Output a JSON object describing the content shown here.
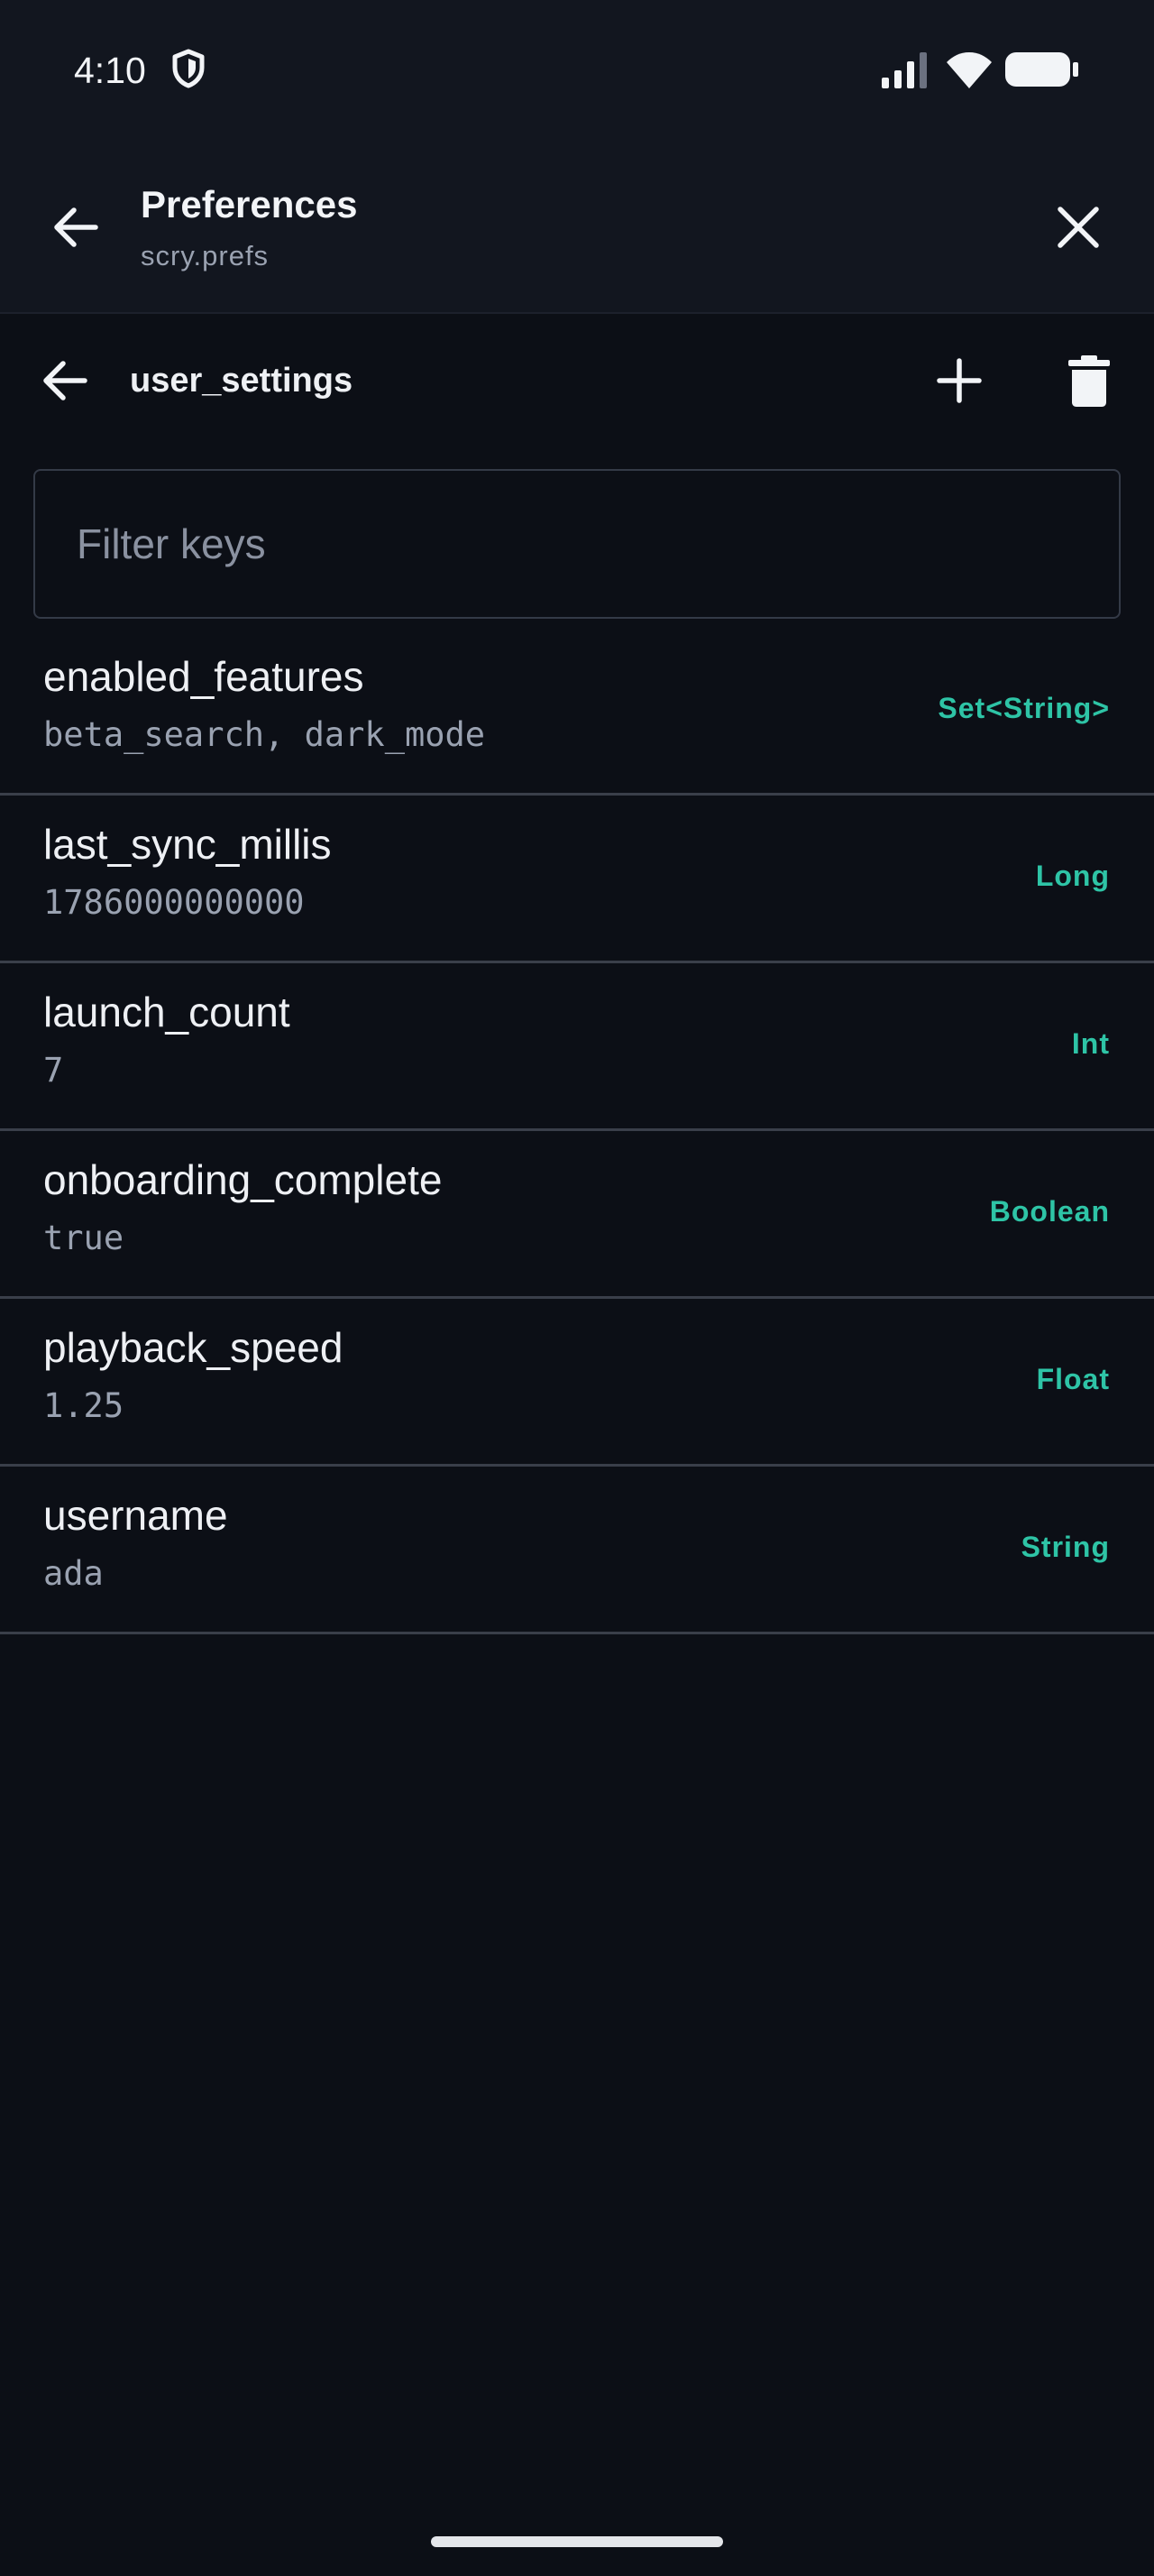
{
  "status_bar": {
    "time": "4:10",
    "icons": [
      "shield-icon",
      "signal-icon",
      "wifi-icon",
      "battery-icon"
    ]
  },
  "top_bar": {
    "title": "Preferences",
    "subtitle": "scry.prefs",
    "icons": [
      "arrow-back-icon",
      "close-icon"
    ]
  },
  "section": {
    "title": "user_settings",
    "icons": [
      "arrow-back-icon",
      "plus-icon",
      "trash-icon"
    ]
  },
  "filter": {
    "placeholder": "Filter keys",
    "value": ""
  },
  "preferences": [
    {
      "key": "enabled_features",
      "value": "beta_search, dark_mode",
      "type": "Set<String>"
    },
    {
      "key": "last_sync_millis",
      "value": "1786000000000",
      "type": "Long"
    },
    {
      "key": "launch_count",
      "value": "7",
      "type": "Int"
    },
    {
      "key": "onboarding_complete",
      "value": "true",
      "type": "Boolean"
    },
    {
      "key": "playback_speed",
      "value": "1.25",
      "type": "Float"
    },
    {
      "key": "username",
      "value": "ada",
      "type": "String"
    }
  ],
  "colors": {
    "background": "#0c0f16",
    "header": "#12161f",
    "accent": "#2ec4a6",
    "text_primary": "#eef0f4",
    "text_secondary": "#9aa2b1",
    "divider": "#3a3f4a"
  }
}
